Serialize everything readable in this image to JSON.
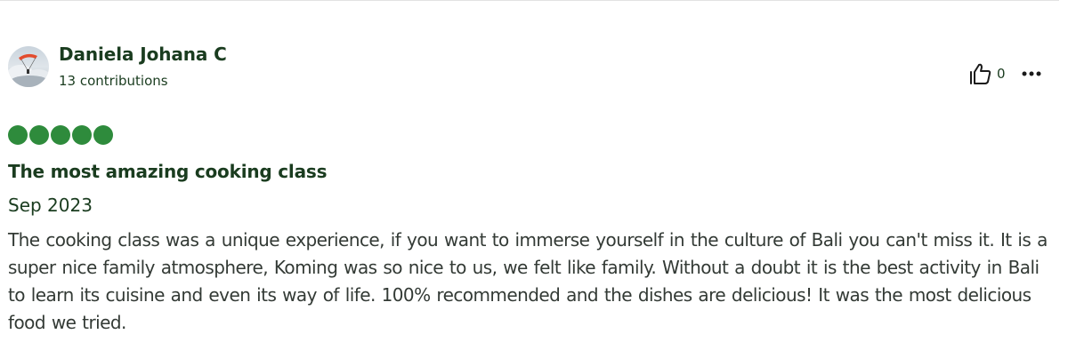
{
  "review": {
    "author": {
      "name": "Daniela Johana C",
      "contributions": "13 contributions"
    },
    "helpful_count": "0",
    "rating": 5,
    "rating_max": 5,
    "title": "The most amazing cooking class",
    "date": "Sep 2023",
    "body": "The cooking class was a unique experience, if you want to immerse yourself in the culture of Bali you can't miss it. It is a super nice family atmosphere, Koming was so nice to us, we felt like family. Without a doubt it is the best activity in Bali to learn its cuisine and even its way of life. 100% recommended and the dishes are delicious! It was the most delicious food we tried."
  },
  "icons": {
    "like": "thumbs-up-icon",
    "more": "more-options-icon"
  },
  "colors": {
    "rating_bubble": "#2e8b3c",
    "text_dark": "#1a3c1f",
    "body_text": "#333a35"
  }
}
